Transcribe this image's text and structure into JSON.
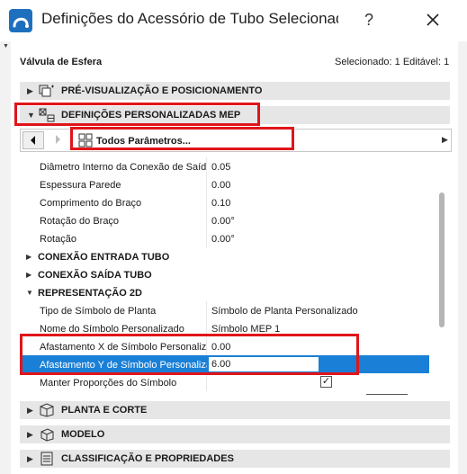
{
  "window": {
    "title": "Definições do Acessório de Tubo Selecionado",
    "help": "?",
    "accent": "#1a7fd6",
    "highlight": "#e0151a"
  },
  "header": {
    "element_name": "Válvula de Esfera",
    "selection_info": "Selecionado: 1 Editável: 1"
  },
  "sections": {
    "preview": "PRÉ-VISUALIZAÇÃO E POSICIONAMENTO",
    "custom_mep": "DEFINIÇÕES PERSONALIZADAS MEP",
    "plan_section": "PLANTA E CORTE",
    "model": "MODELO",
    "classification": "CLASSIFICAÇÃO E PROPRIEDADES"
  },
  "navigator": {
    "label": "Todos Parâmetros..."
  },
  "params": {
    "rows": [
      {
        "k": "Diâmetro Interno da Conexão de Saída",
        "v": "0.05"
      },
      {
        "k": "Espessura Parede",
        "v": "0.00"
      },
      {
        "k": "Comprimento do Braço",
        "v": "0.10"
      },
      {
        "k": "Rotação do Braço",
        "v": "0.00°"
      },
      {
        "k": "Rotação",
        "v": "0.00°"
      }
    ],
    "group_in": "CONEXÃO ENTRADA TUBO",
    "group_out": "CONEXÃO SAÍDA TUBO",
    "group_2d": "REPRESENTAÇÃO 2D",
    "rows_2d": [
      {
        "k": "Tipo de Símbolo de Planta",
        "v": "Símbolo de Planta Personalizado"
      },
      {
        "k": "Nome do Símbolo Personalizado",
        "v": "Símbolo MEP 1"
      },
      {
        "k": "Afastamento X de Símbolo Personalizado",
        "v": "0.00"
      }
    ],
    "selected": {
      "k": "Afastamento Y de Símbolo Personalizado",
      "v": "6.00"
    },
    "keep_proportions": {
      "k": "Manter Proporções do Símbolo",
      "checked": true
    }
  }
}
